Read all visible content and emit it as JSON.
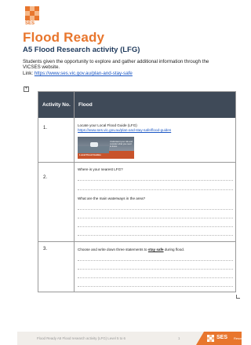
{
  "logo": {
    "text": "SES",
    "colors": [
      "#e8762d",
      "#f6b98a",
      "#ffffff"
    ]
  },
  "header": {
    "title": "Flood Ready",
    "subtitle": "A5 Flood Research activity (LFG)"
  },
  "intro": {
    "line1": "Students given the opportunity to explore and gather additional information through the",
    "line2": "VICSES website.",
    "link_label": "Link: ",
    "link": "https://www.ses.vic.gov.au/plan-and-stay-safe"
  },
  "table": {
    "headers": [
      "Activity No.",
      "Flood"
    ],
    "rows": [
      {
        "number": "1.",
        "text": "Locate your Local Flood Guide (LFG)",
        "link": "https://www.ses.vic.gov.au/plan-and-stay-safe/flood-guides",
        "banner_caption": "Understand your risk and consider what you need to know.",
        "banner_footer": "Local Flood Guides"
      },
      {
        "number": "2.",
        "question": "Where is your nearest LFG?"
      },
      {
        "question": "What are the main waterways in the area?"
      },
      {
        "number": "3.",
        "question_before": "Choose and write down three statements to ",
        "question_emphasis": "stay safe",
        "question_after": " during flood."
      }
    ]
  },
  "footer": {
    "text": "Flood Ready    A5  Flood research activity  (LFG)   Level 5 to 6",
    "page": "1",
    "brand": "SES",
    "brand_tail": "Resource",
    "accent": "#e8762d"
  }
}
